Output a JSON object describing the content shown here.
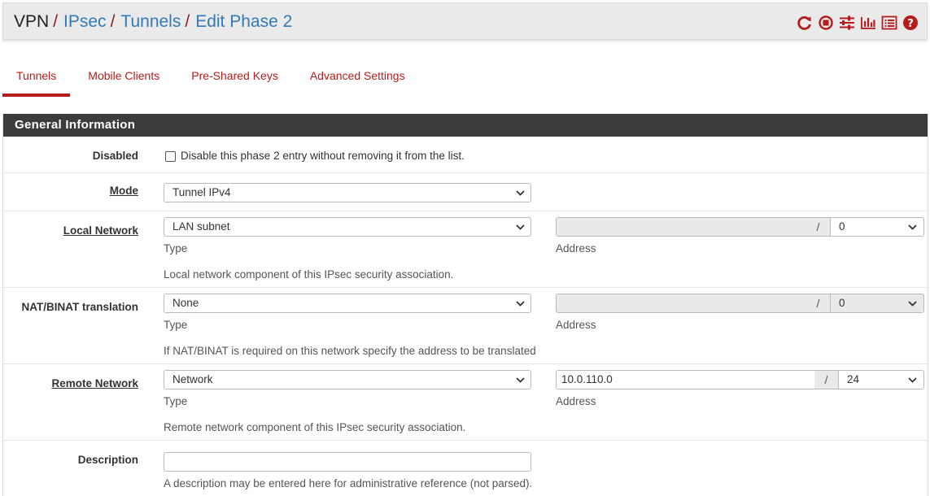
{
  "breadcrumb": {
    "root": "VPN",
    "items": [
      "IPsec",
      "Tunnels",
      "Edit Phase 2"
    ],
    "separator": "/"
  },
  "header_icons": [
    "reload-icon",
    "stop-icon",
    "sliders-icon",
    "bar-chart-icon",
    "list-icon",
    "help-icon"
  ],
  "tabs": [
    {
      "label": "Tunnels",
      "active": true
    },
    {
      "label": "Mobile Clients",
      "active": false
    },
    {
      "label": "Pre-Shared Keys",
      "active": false
    },
    {
      "label": "Advanced Settings",
      "active": false
    }
  ],
  "panel": {
    "title": "General Information"
  },
  "disabled": {
    "label": "Disabled",
    "checkbox_text": "Disable this phase 2 entry without removing it from the list.",
    "checked": false
  },
  "mode": {
    "label": "Mode",
    "value": "Tunnel IPv4"
  },
  "local_network": {
    "label": "Local Network",
    "type_value": "LAN subnet",
    "type_caption": "Type",
    "address_value": "",
    "mask_value": "0",
    "address_caption": "Address",
    "help": "Local network component of this IPsec security association."
  },
  "nat_binat": {
    "label": "NAT/BINAT translation",
    "type_value": "None",
    "type_caption": "Type",
    "address_value": "",
    "mask_value": "0",
    "address_caption": "Address",
    "help": "If NAT/BINAT is required on this network specify the address to be translated"
  },
  "remote_network": {
    "label": "Remote Network",
    "type_value": "Network",
    "type_caption": "Type",
    "address_value": "10.0.110.0",
    "mask_value": "24",
    "address_caption": "Address",
    "help": "Remote network component of this IPsec security association."
  },
  "description": {
    "label": "Description",
    "value": "",
    "help": "A description may be entered here for administrative reference (not parsed)."
  },
  "colors": {
    "accent": "#b71c1c",
    "link": "#337ab7",
    "panel_heading": "#3c3c3c"
  },
  "address_separator": "/"
}
